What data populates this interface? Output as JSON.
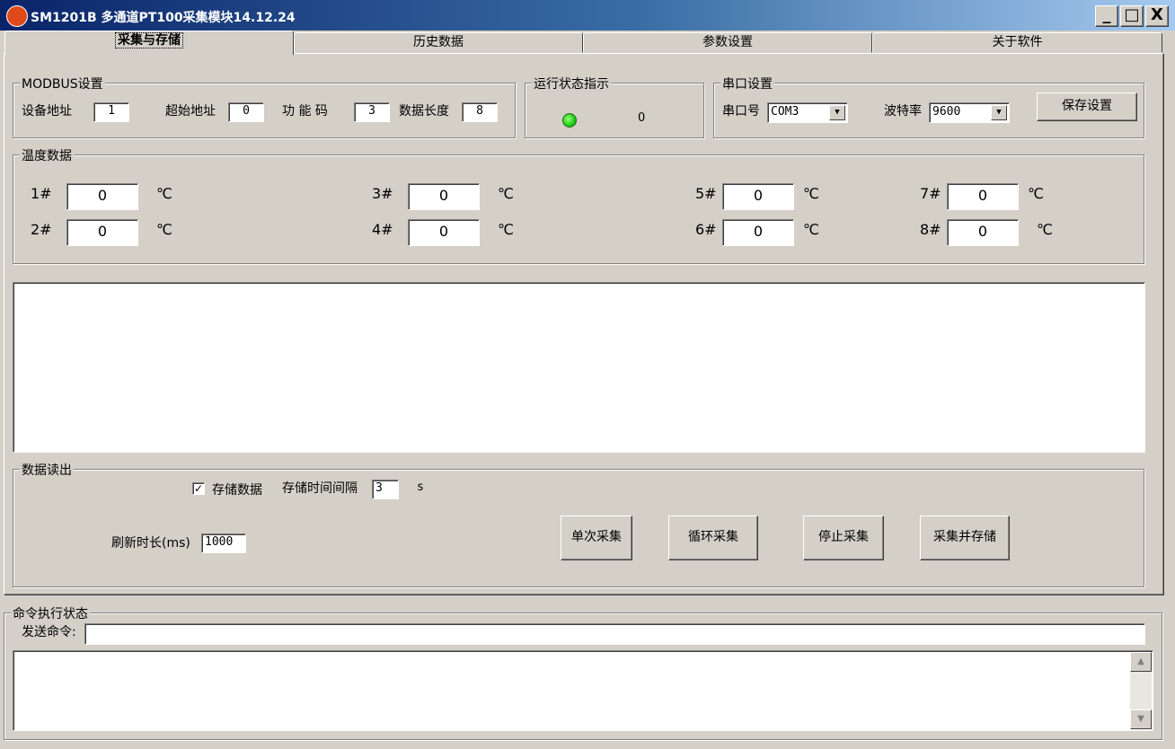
{
  "window": {
    "title": "SM1201B 多通道PT100采集模块14.12.24",
    "minimize": "_",
    "maximize": "□",
    "close": "X"
  },
  "tabs": [
    {
      "label": "采集与存储"
    },
    {
      "label": "历史数据"
    },
    {
      "label": "参数设置"
    },
    {
      "label": "关于软件"
    }
  ],
  "modbus": {
    "legend": "MODBUS设置",
    "device_addr_label": "设备地址",
    "device_addr": "1",
    "start_addr_label": "超始地址",
    "start_addr": "0",
    "func_code_label": "功 能 码",
    "func_code": "3",
    "data_len_label": "数据长度",
    "data_len": "8"
  },
  "status": {
    "legend": "运行状态指示",
    "led_color": "#22d11a",
    "count": "0"
  },
  "serial": {
    "legend": "串口设置",
    "port_label": "串口号",
    "port": "COM3",
    "baud_label": "波特率",
    "baud": "9600",
    "save_button": "保存设置"
  },
  "temperature": {
    "legend": "温度数据",
    "unit": "℃",
    "channels": [
      {
        "label": "1#",
        "value": "0"
      },
      {
        "label": "2#",
        "value": "0"
      },
      {
        "label": "3#",
        "value": "0"
      },
      {
        "label": "4#",
        "value": "0"
      },
      {
        "label": "5#",
        "value": "0"
      },
      {
        "label": "6#",
        "value": "0"
      },
      {
        "label": "7#",
        "value": "0"
      },
      {
        "label": "8#",
        "value": "0"
      }
    ]
  },
  "readout": {
    "legend": "数据读出",
    "store_checkbox_label": "存储数据",
    "store_checked": "✓",
    "interval_label": "存储时间间隔",
    "interval": "3",
    "interval_unit": "s",
    "refresh_label": "刷新时长(ms)",
    "refresh": "1000",
    "buttons": {
      "single": "单次采集",
      "loop": "循环采集",
      "stop": "停止采集",
      "collect_store": "采集并存储"
    }
  },
  "command": {
    "legend": "命令执行状态",
    "send_label": "发送命令:",
    "send_value": ""
  }
}
